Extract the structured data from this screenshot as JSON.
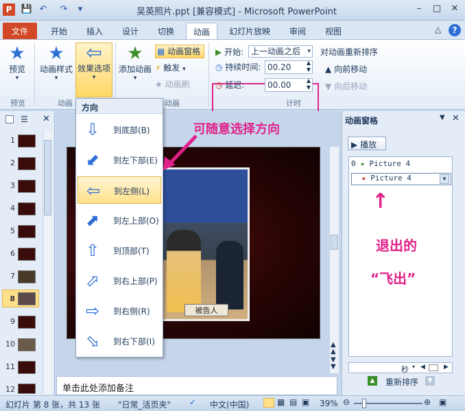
{
  "titlebar": {
    "title": "吴英照片.ppt [兼容模式] - Microsoft PowerPoint"
  },
  "tabs": [
    "文件",
    "开始",
    "插入",
    "设计",
    "切换",
    "动画",
    "幻灯片放映",
    "审阅",
    "视图"
  ],
  "ribbon": {
    "preview": {
      "label": "预览",
      "group": "预览"
    },
    "anim_style": "动画样式",
    "effect_options": "效果选项",
    "group_anim": "动画",
    "add_anim": "添加动画",
    "anim_pane": "动画窗格",
    "trigger": "触发",
    "anim_painter": "动画刷",
    "group_adv": "动画",
    "start_label": "开始:",
    "start_value": "上一动画之后",
    "duration_label": "持续时间:",
    "duration_value": "00.20",
    "delay_label": "延迟:",
    "delay_value": "00.00",
    "group_timing": "计时",
    "reorder_title": "对动画重新排序",
    "move_earlier": "向前移动",
    "move_later": "向后移动"
  },
  "direction_menu": {
    "header": "方向",
    "items": [
      "到底部(B)",
      "到左下部(E)",
      "到左侧(L)",
      "到左上部(O)",
      "到顶部(T)",
      "到右上部(P)",
      "到右侧(R)",
      "到右下部(I)"
    ],
    "selected_index": 2
  },
  "thumbnails": [
    "1",
    "2",
    "3",
    "4",
    "5",
    "6",
    "7",
    "8",
    "9",
    "10",
    "11",
    "12"
  ],
  "current_slide": "8",
  "slide": {
    "nameplate": "被告人"
  },
  "annotations": {
    "top": "可随意选择方向",
    "line1": "退出的",
    "line2": "“飞出”"
  },
  "notes_placeholder": "单击此处添加备注",
  "anim_pane": {
    "title": "动画窗格",
    "play": "播放",
    "items": [
      {
        "index": "0",
        "name": "Picture 4"
      },
      {
        "index": "",
        "name": "Picture 4"
      }
    ],
    "seconds": "秒",
    "reorder": "重新排序"
  },
  "status": {
    "slide_info": "幻灯片 第 8 张，共 13 张",
    "theme": "\"日常_活页夹\"",
    "language": "中文(中国)",
    "zoom": "39%"
  },
  "colors": {
    "file_tab": "#d24726",
    "accent_magenta": "#e0218a",
    "icon_blue": "#2e6fd6"
  }
}
